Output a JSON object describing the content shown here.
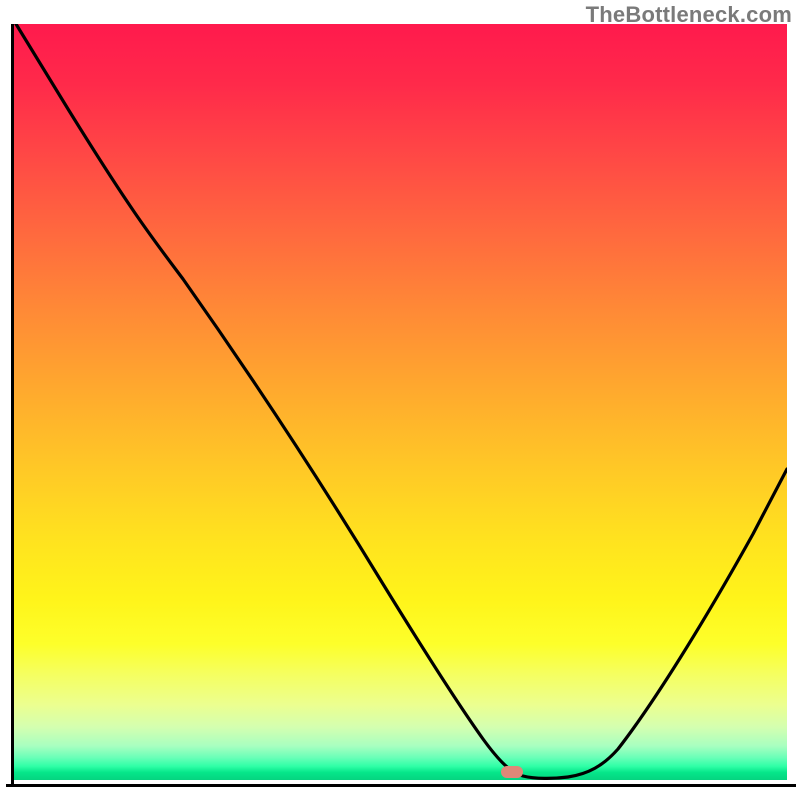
{
  "watermark": "TheBottleneck.com",
  "chart_data": {
    "type": "line",
    "title": "",
    "xlabel": "",
    "ylabel": "",
    "xlim": [
      0,
      100
    ],
    "ylim": [
      0,
      100
    ],
    "grid": false,
    "legend": false,
    "background": "red-yellow-green vertical gradient",
    "x": [
      0,
      6,
      18,
      28,
      38,
      48,
      52,
      56,
      60,
      62,
      64,
      68,
      72,
      76,
      80,
      85,
      90,
      95,
      100
    ],
    "values": [
      100,
      89,
      73,
      62,
      47,
      31,
      25,
      18,
      11,
      7,
      3,
      1,
      0,
      0,
      5,
      14,
      26,
      39,
      52
    ],
    "marker": {
      "x": 64.5,
      "y": 0.8
    },
    "annotations": []
  },
  "colors": {
    "curve": "#000000",
    "axes": "#000000",
    "marker": "#e08878",
    "watermark": "#7a7a7a"
  }
}
